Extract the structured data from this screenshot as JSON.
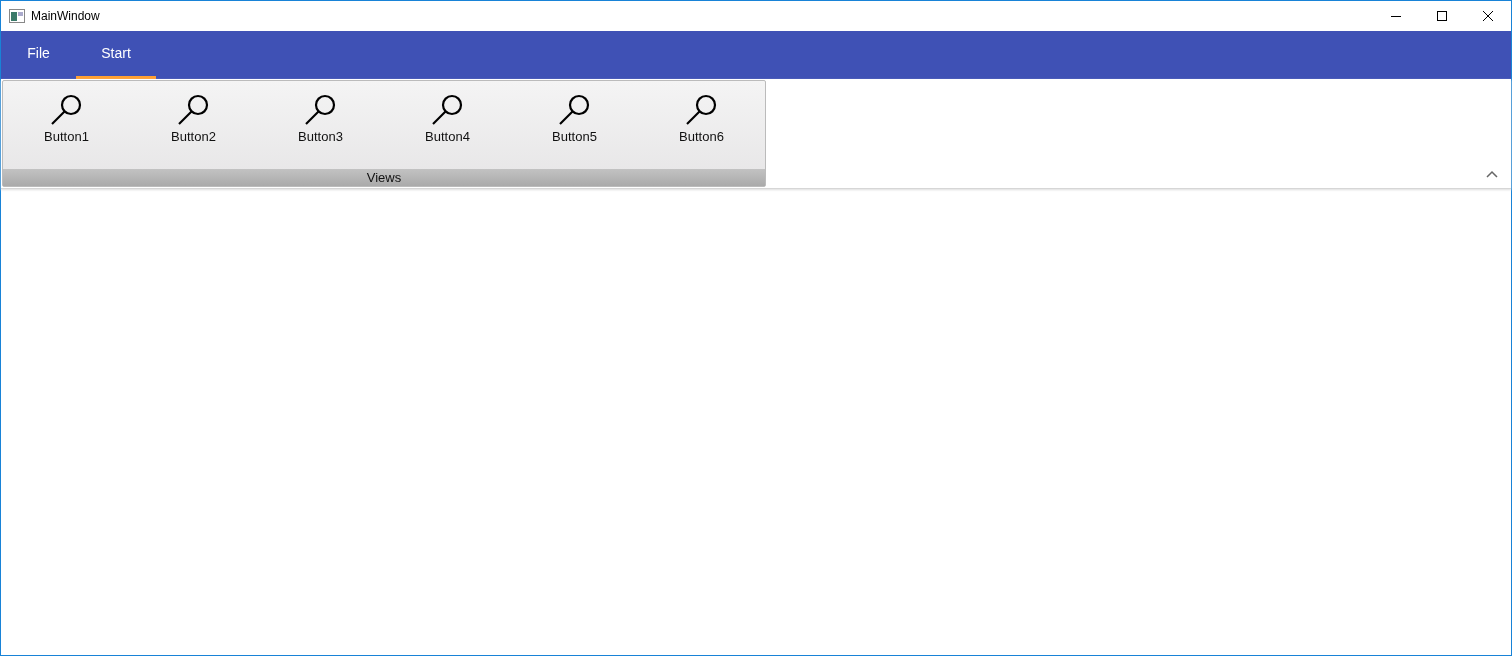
{
  "window": {
    "title": "MainWindow"
  },
  "tabs": [
    {
      "label": "File",
      "selected": false
    },
    {
      "label": "Start",
      "selected": true
    }
  ],
  "ribbon": {
    "groups": [
      {
        "label": "Views",
        "buttons": [
          "Button1",
          "Button2",
          "Button3",
          "Button4",
          "Button5",
          "Button6"
        ]
      }
    ],
    "expanded": true
  }
}
